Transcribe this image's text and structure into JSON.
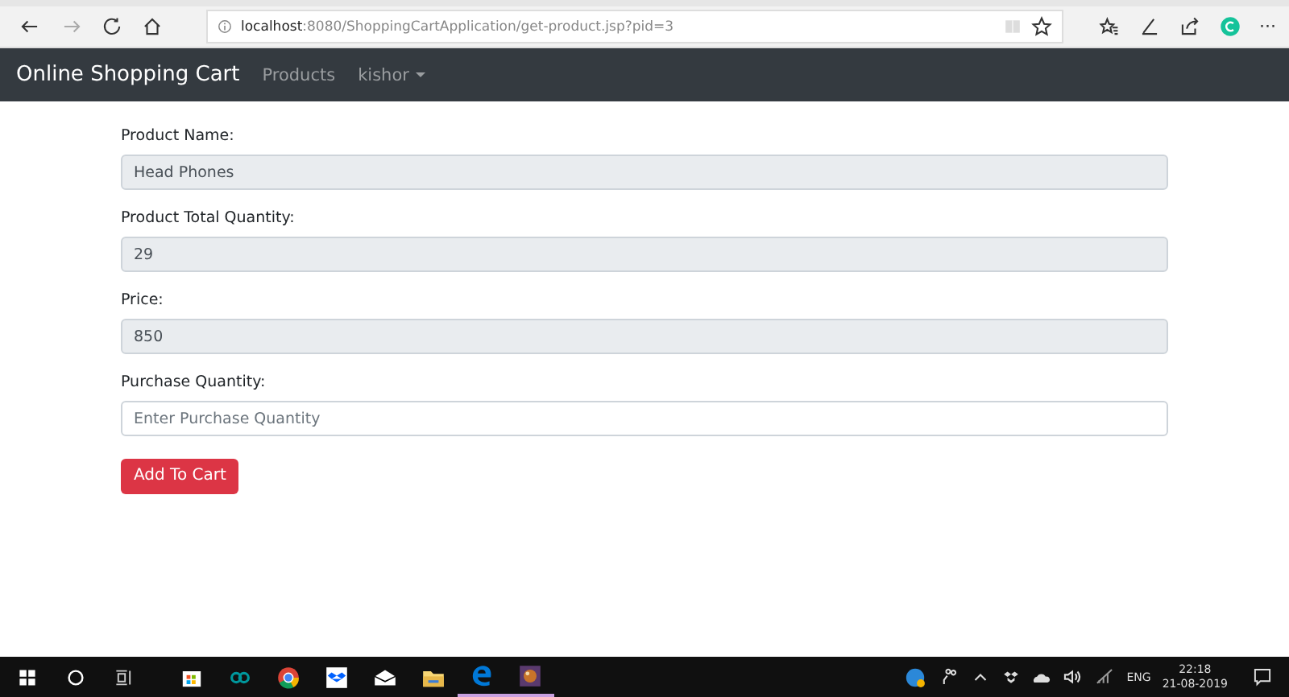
{
  "browser": {
    "url": "**localhost**:8080/ShoppingCartApplication/get-product.jsp?pid=3",
    "more": "···"
  },
  "navbar": {
    "brand": "Online Shopping Cart",
    "links": [
      {
        "label": "Products",
        "kind": "link"
      },
      {
        "label": "kishor",
        "kind": "dropdown"
      }
    ]
  },
  "form": {
    "fields": [
      {
        "label": "Product Name:",
        "value": "Head Phones",
        "disabled": true
      },
      {
        "label": "Product Total Quantity:",
        "value": "29",
        "disabled": true
      },
      {
        "label": "Price:",
        "value": "850",
        "disabled": true
      },
      {
        "label": "Purchase Quantity:",
        "placeholder": "Enter Purchase Quantity",
        "disabled": false
      }
    ],
    "button": "Add To Cart"
  },
  "taskbar": {
    "apps": [
      {
        "kind": "store",
        "running": false
      },
      {
        "kind": "infinity",
        "running": false
      },
      {
        "kind": "chrome",
        "running": false
      },
      {
        "kind": "dropbox",
        "running": false
      },
      {
        "kind": "mail",
        "running": false
      },
      {
        "kind": "folder",
        "running": false
      },
      {
        "kind": "edge",
        "running": true
      },
      {
        "kind": "app",
        "running": true
      }
    ],
    "language": "ENG",
    "time": "22:18",
    "date": "21-08-2019"
  }
}
